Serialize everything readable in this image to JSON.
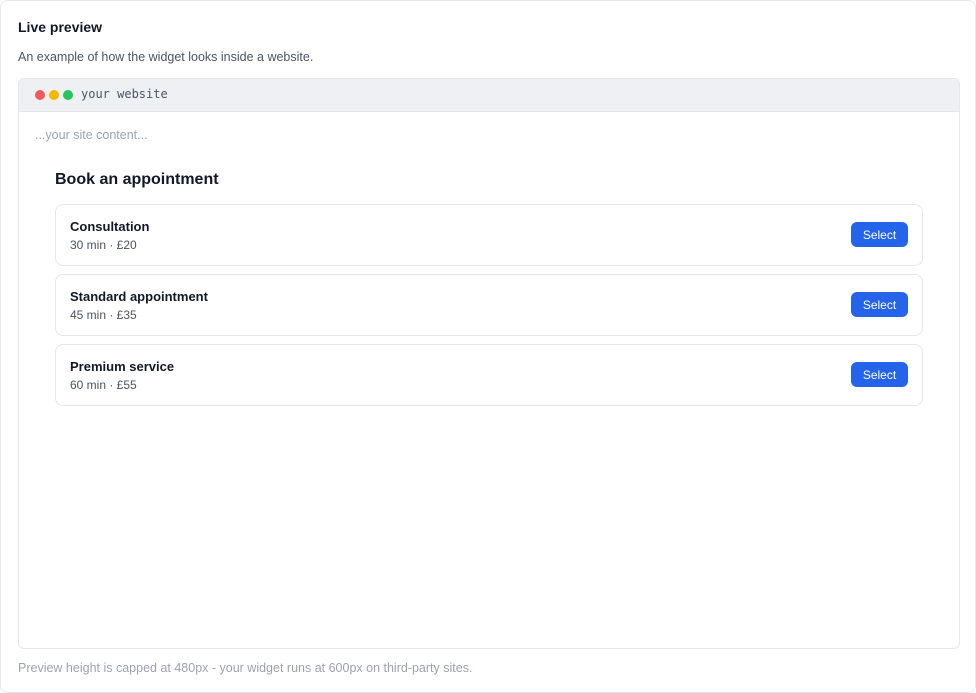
{
  "panel": {
    "title": "Live preview",
    "description": "An example of how the widget looks inside a website.",
    "footnote": "Preview height is capped at 480px - your widget runs at 600px on third-party sites."
  },
  "browser": {
    "url_label": "your website",
    "dots": [
      {
        "name": "close-dot",
        "color": "#ef5b5b"
      },
      {
        "name": "minimize-dot",
        "color": "#f5b700"
      },
      {
        "name": "maximize-dot",
        "color": "#22c55e"
      }
    ],
    "placeholder_content": "...your site content..."
  },
  "widget": {
    "title": "Book an appointment",
    "accent_color": "#2563eb",
    "services": [
      {
        "name": "Consultation",
        "meta": "30 min · £20",
        "button_label": "Select"
      },
      {
        "name": "Standard appointment",
        "meta": "45 min · £35",
        "button_label": "Select"
      },
      {
        "name": "Premium service",
        "meta": "60 min · £55",
        "button_label": "Select"
      }
    ]
  }
}
